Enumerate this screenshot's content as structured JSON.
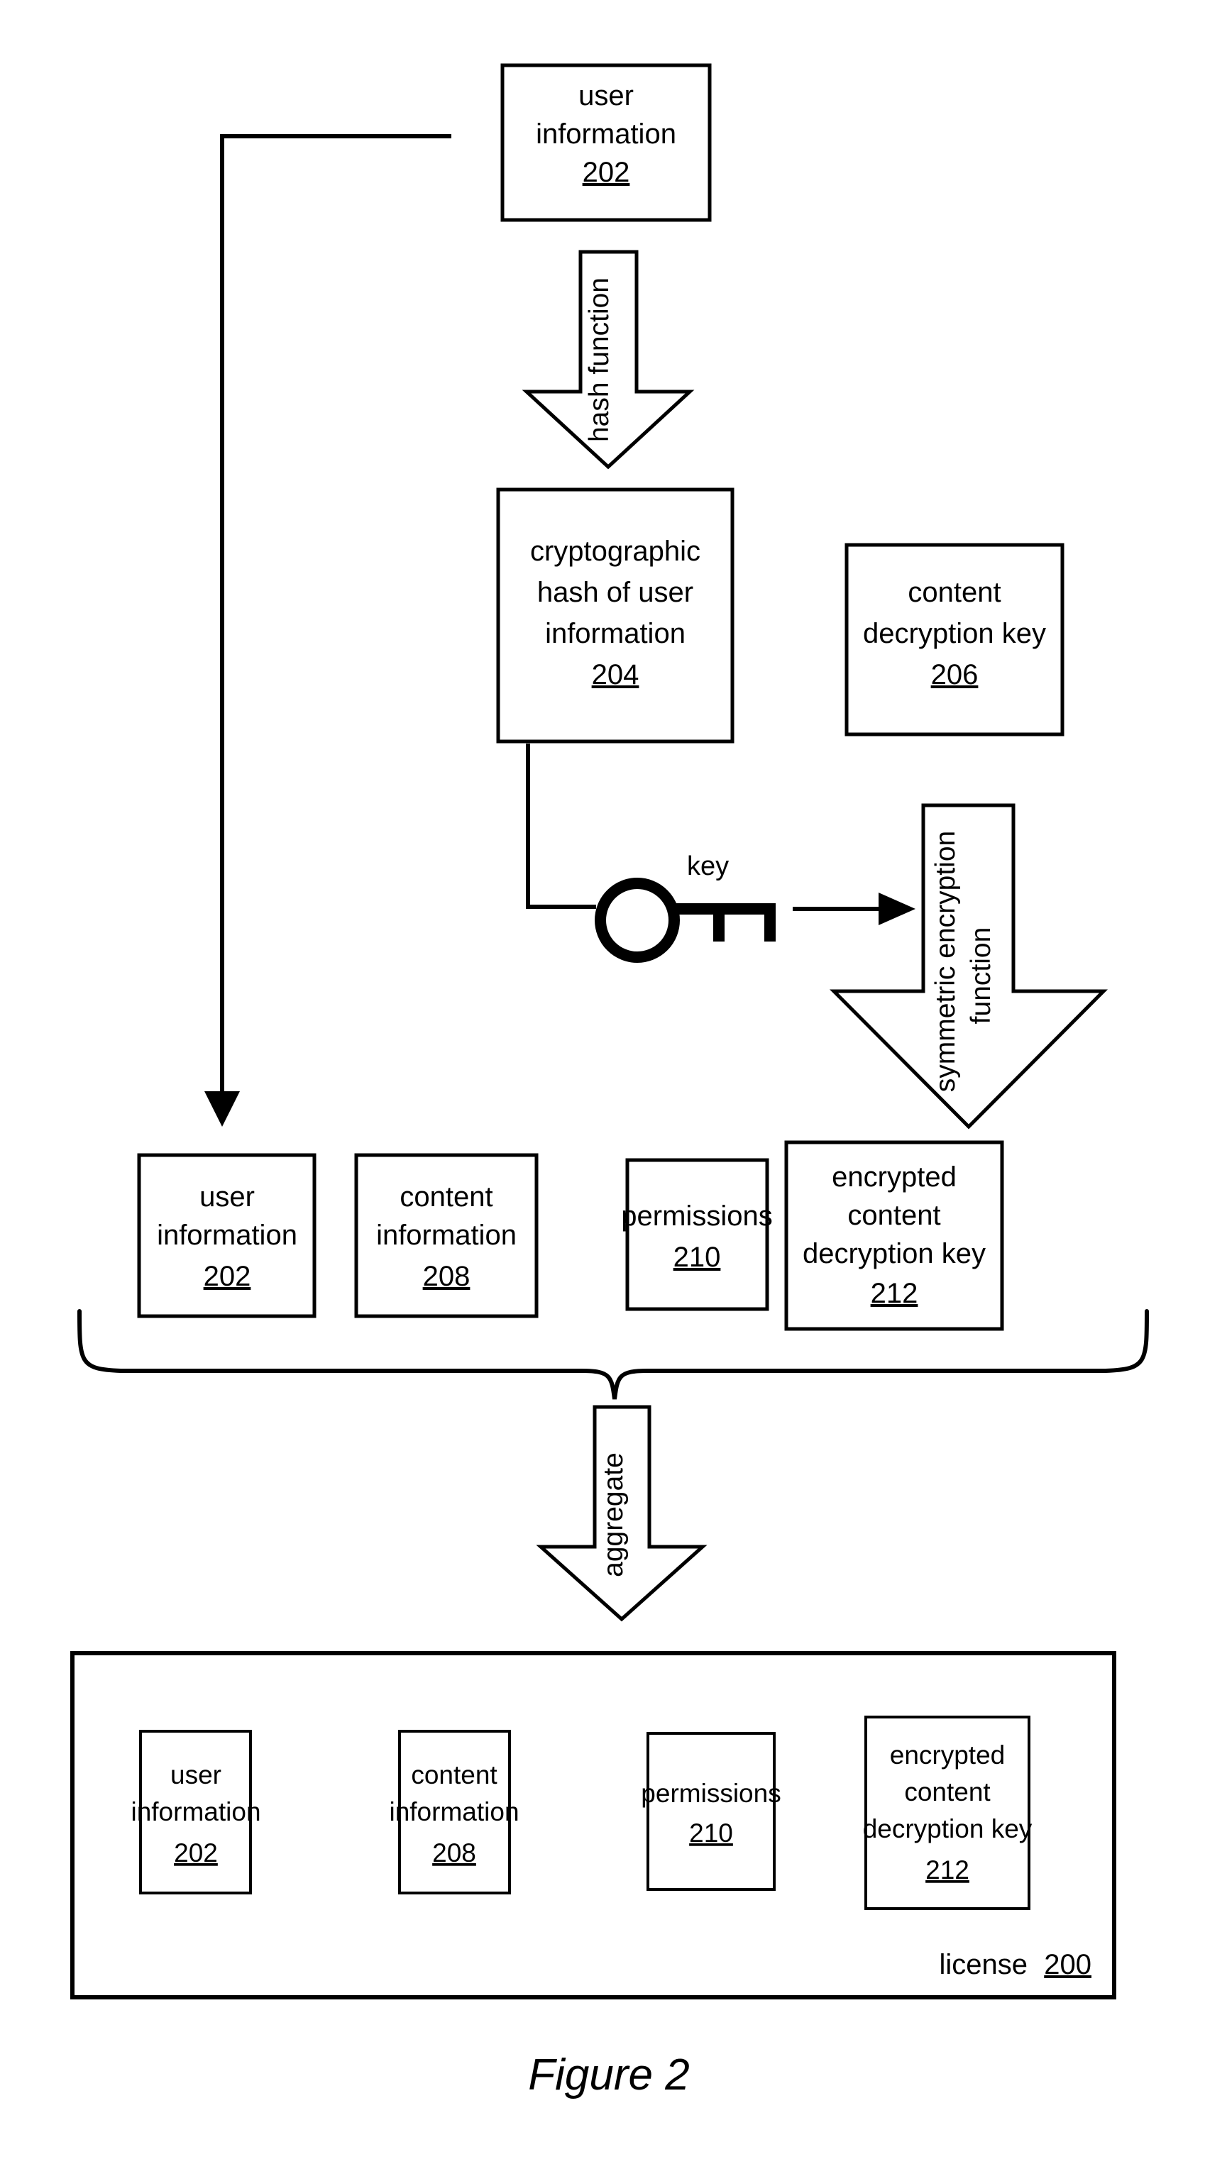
{
  "figure": {
    "caption": "Figure 2",
    "container_label": "license",
    "container_ref": "200"
  },
  "nodes": {
    "user_information_top": {
      "line1": "user",
      "line2": "information",
      "ref": "202"
    },
    "crypto_hash": {
      "line1": "cryptographic",
      "line2": "hash of user",
      "line3": "information",
      "ref": "204"
    },
    "content_decryption_key": {
      "line1": "content",
      "line2": "decryption key",
      "ref": "206"
    },
    "user_information_mid": {
      "line1": "user",
      "line2": "information",
      "ref": "202"
    },
    "content_information_mid": {
      "line1": "content",
      "line2": "information",
      "ref": "208"
    },
    "permissions_mid": {
      "line1": "permissions",
      "ref": "210"
    },
    "encrypted_key_mid": {
      "line1": "encrypted",
      "line2": "content",
      "line3": "decryption key",
      "ref": "212"
    },
    "user_information_license": {
      "line1": "user",
      "line2": "information",
      "ref": "202"
    },
    "content_information_license": {
      "line1": "content",
      "line2": "information",
      "ref": "208"
    },
    "permissions_license": {
      "line1": "permissions",
      "ref": "210"
    },
    "encrypted_key_license": {
      "line1": "encrypted",
      "line2": "content",
      "line3": "decryption key",
      "ref": "212"
    }
  },
  "arrows": {
    "hash_function": {
      "label": "hash function"
    },
    "symmetric_encryption": {
      "label_line1": "symmetric encryption",
      "label_line2": "function"
    },
    "aggregate": {
      "label": "aggregate"
    }
  },
  "icons": {
    "key": {
      "label": "key"
    }
  },
  "colors": {
    "stroke": "#000000",
    "background": "#ffffff"
  }
}
